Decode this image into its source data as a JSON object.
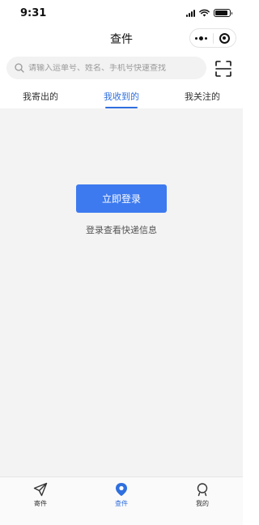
{
  "status_bar": {
    "time": "9:31",
    "battery_level": 0.9
  },
  "nav": {
    "title": "查件",
    "menu_icon": "more-dots-icon",
    "close_icon": "target-circle-icon"
  },
  "search": {
    "placeholder": "请输入运单号、姓名、手机号快速查找",
    "value": "",
    "scan_icon": "scan-icon"
  },
  "tabs": [
    {
      "label": "我寄出的",
      "active": false
    },
    {
      "label": "我收到的",
      "active": true
    },
    {
      "label": "我关注的",
      "active": false
    }
  ],
  "main": {
    "login_button": "立即登录",
    "login_hint": "登录查看快递信息"
  },
  "tabbar": [
    {
      "label": "寄件",
      "icon": "paper-plane-icon",
      "active": false
    },
    {
      "label": "查件",
      "icon": "location-pin-icon",
      "active": true
    },
    {
      "label": "我的",
      "icon": "user-icon",
      "active": false
    }
  ],
  "colors": {
    "accent": "#2f6fdf",
    "button": "#3d7af0",
    "background": "#f3f3f4"
  }
}
